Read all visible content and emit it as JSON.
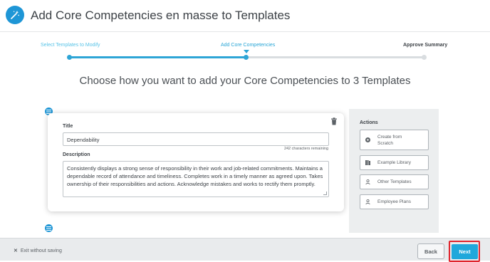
{
  "header": {
    "title": "Add Core Competencies en masse to Templates",
    "icon": "magic-wand-icon"
  },
  "stepper": {
    "steps": [
      {
        "label": "Select Templates to Modify",
        "state": "done"
      },
      {
        "label": "Add Core Competencies",
        "state": "current"
      },
      {
        "label": "Approve Summary",
        "state": "todo"
      }
    ],
    "progress_steps_completed": 2,
    "progress_steps_total": 3
  },
  "main": {
    "heading": "Choose how you want to add your Core Competencies to 3 Templates"
  },
  "card": {
    "title_label": "Title",
    "title_value": "Dependability",
    "char_count": "242 characters remaining",
    "description_label": "Description",
    "description_value": "Consistently displays a strong sense of responsibility in their work and job-related commitments. Maintains a dependable record of attendance and timeliness. Completes work in a timely manner as agreed upon.  Takes ownership of their responsibilities and actions. Acknowledge mistakes and works to rectify them promptly."
  },
  "actions": {
    "title": "Actions",
    "items": [
      {
        "label": "Create from Scratch",
        "icon": "plus-circle-icon"
      },
      {
        "label": "Example Library",
        "icon": "library-icon"
      },
      {
        "label": "Other Templates",
        "icon": "user-icon"
      },
      {
        "label": "Employee Plans",
        "icon": "user-icon"
      }
    ]
  },
  "footer": {
    "exit_label": "Exit without saving",
    "back_label": "Back",
    "next_label": "Next"
  },
  "colors": {
    "accent": "#1e96d6",
    "primary_button": "#20a8db",
    "highlight": "#e0242c"
  }
}
